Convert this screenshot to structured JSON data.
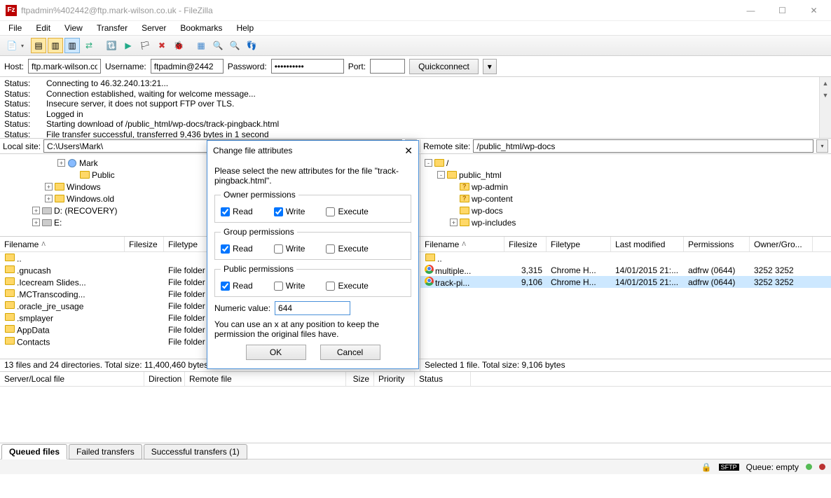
{
  "title": "ftpadmin%402442@ftp.mark-wilson.co.uk - FileZilla",
  "menu": [
    "File",
    "Edit",
    "View",
    "Transfer",
    "Server",
    "Bookmarks",
    "Help"
  ],
  "qc": {
    "host_label": "Host:",
    "host": "ftp.mark-wilson.co",
    "user_label": "Username:",
    "user": "ftpadmin@2442",
    "pass_label": "Password:",
    "pass": "••••••••••",
    "port_label": "Port:",
    "port": "",
    "btn": "Quickconnect"
  },
  "log": [
    {
      "l": "Status:",
      "m": "Connecting to 46.32.240.13:21..."
    },
    {
      "l": "Status:",
      "m": "Connection established, waiting for welcome message..."
    },
    {
      "l": "Status:",
      "m": "Insecure server, it does not support FTP over TLS."
    },
    {
      "l": "Status:",
      "m": "Logged in"
    },
    {
      "l": "Status:",
      "m": "Starting download of /public_html/wp-docs/track-pingback.html"
    },
    {
      "l": "Status:",
      "m": "File transfer successful, transferred 9,436 bytes in 1 second"
    }
  ],
  "local_site_label": "Local site:",
  "local_site": "C:\\Users\\Mark\\",
  "remote_site_label": "Remote site:",
  "remote_site": "/public_html/wp-docs",
  "local_tree": [
    {
      "indent": 80,
      "exp": "+",
      "icon": "person",
      "label": "Mark"
    },
    {
      "indent": 98,
      "exp": "",
      "icon": "folder",
      "label": "Public"
    },
    {
      "indent": 62,
      "exp": "+",
      "icon": "folder",
      "label": "Windows"
    },
    {
      "indent": 62,
      "exp": "+",
      "icon": "folder",
      "label": "Windows.old"
    },
    {
      "indent": 44,
      "exp": "+",
      "icon": "drive",
      "label": "D: (RECOVERY)"
    },
    {
      "indent": 44,
      "exp": "+",
      "icon": "drive",
      "label": "E:"
    }
  ],
  "remote_tree": [
    {
      "indent": 4,
      "exp": "-",
      "icon": "folder",
      "label": "/"
    },
    {
      "indent": 22,
      "exp": "-",
      "icon": "folder",
      "label": "public_html"
    },
    {
      "indent": 40,
      "exp": "",
      "icon": "folderq",
      "label": "wp-admin"
    },
    {
      "indent": 40,
      "exp": "",
      "icon": "folderq",
      "label": "wp-content"
    },
    {
      "indent": 40,
      "exp": "",
      "icon": "folder",
      "label": "wp-docs"
    },
    {
      "indent": 40,
      "exp": "+",
      "icon": "folder",
      "label": "wp-includes"
    }
  ],
  "local_cols": [
    "Filename",
    "Filesize",
    "Filetype"
  ],
  "local_cw": [
    178,
    56,
    90
  ],
  "local_rows": [
    {
      "n": "..",
      "s": "",
      "t": ""
    },
    {
      "n": ".gnucash",
      "s": "",
      "t": "File folder"
    },
    {
      "n": ".Icecream Slides...",
      "s": "",
      "t": "File folder"
    },
    {
      "n": ".MCTranscoding...",
      "s": "",
      "t": "File folder"
    },
    {
      "n": ".oracle_jre_usage",
      "s": "",
      "t": "File folder"
    },
    {
      "n": ".smplayer",
      "s": "",
      "t": "File folder"
    },
    {
      "n": "AppData",
      "s": "",
      "t": "File folder"
    },
    {
      "n": "Contacts",
      "s": "",
      "t": "File folder"
    }
  ],
  "remote_cols": [
    "Filename",
    "Filesize",
    "Filetype",
    "Last modified",
    "Permissions",
    "Owner/Gro..."
  ],
  "remote_cw": [
    120,
    60,
    92,
    104,
    94,
    90
  ],
  "remote_rows": [
    {
      "n": "..",
      "s": "",
      "t": "",
      "m": "",
      "p": "",
      "o": "",
      "ico": "folder"
    },
    {
      "n": "multiple...",
      "s": "3,315",
      "t": "Chrome H...",
      "m": "14/01/2015 21:...",
      "p": "adfrw (0644)",
      "o": "3252 3252",
      "ico": "chrome"
    },
    {
      "n": "track-pi...",
      "s": "9,106",
      "t": "Chrome H...",
      "m": "14/01/2015 21:...",
      "p": "adfrw (0644)",
      "o": "3252 3252",
      "ico": "chrome",
      "sel": true
    }
  ],
  "local_status": "13 files and 24 directories. Total size: 11,400,460 bytes",
  "remote_status": "Selected 1 file. Total size: 9,106 bytes",
  "queue_cols": [
    "Server/Local file",
    "Direction",
    "Remote file",
    "Size",
    "Priority",
    "Status"
  ],
  "queue_cw": [
    206,
    58,
    230,
    40,
    58,
    80
  ],
  "tabs": [
    {
      "l": "Queued files",
      "a": true
    },
    {
      "l": "Failed transfers",
      "a": false
    },
    {
      "l": "Successful transfers (1)",
      "a": false
    }
  ],
  "bottom": {
    "queue": "Queue: empty"
  },
  "dialog": {
    "title": "Change file attributes",
    "intro": "Please select the new attributes for the file \"track-pingback.html\".",
    "groups": [
      {
        "t": "Owner permissions",
        "r": true,
        "w": true,
        "x": false
      },
      {
        "t": "Group permissions",
        "r": true,
        "w": false,
        "x": false
      },
      {
        "t": "Public permissions",
        "r": true,
        "w": false,
        "x": false
      }
    ],
    "labels": {
      "read": "Read",
      "write": "Write",
      "execute": "Execute"
    },
    "num_label": "Numeric value:",
    "num": "644",
    "hint": "You can use an x at any position to keep the permission the original files have.",
    "ok": "OK",
    "cancel": "Cancel"
  }
}
